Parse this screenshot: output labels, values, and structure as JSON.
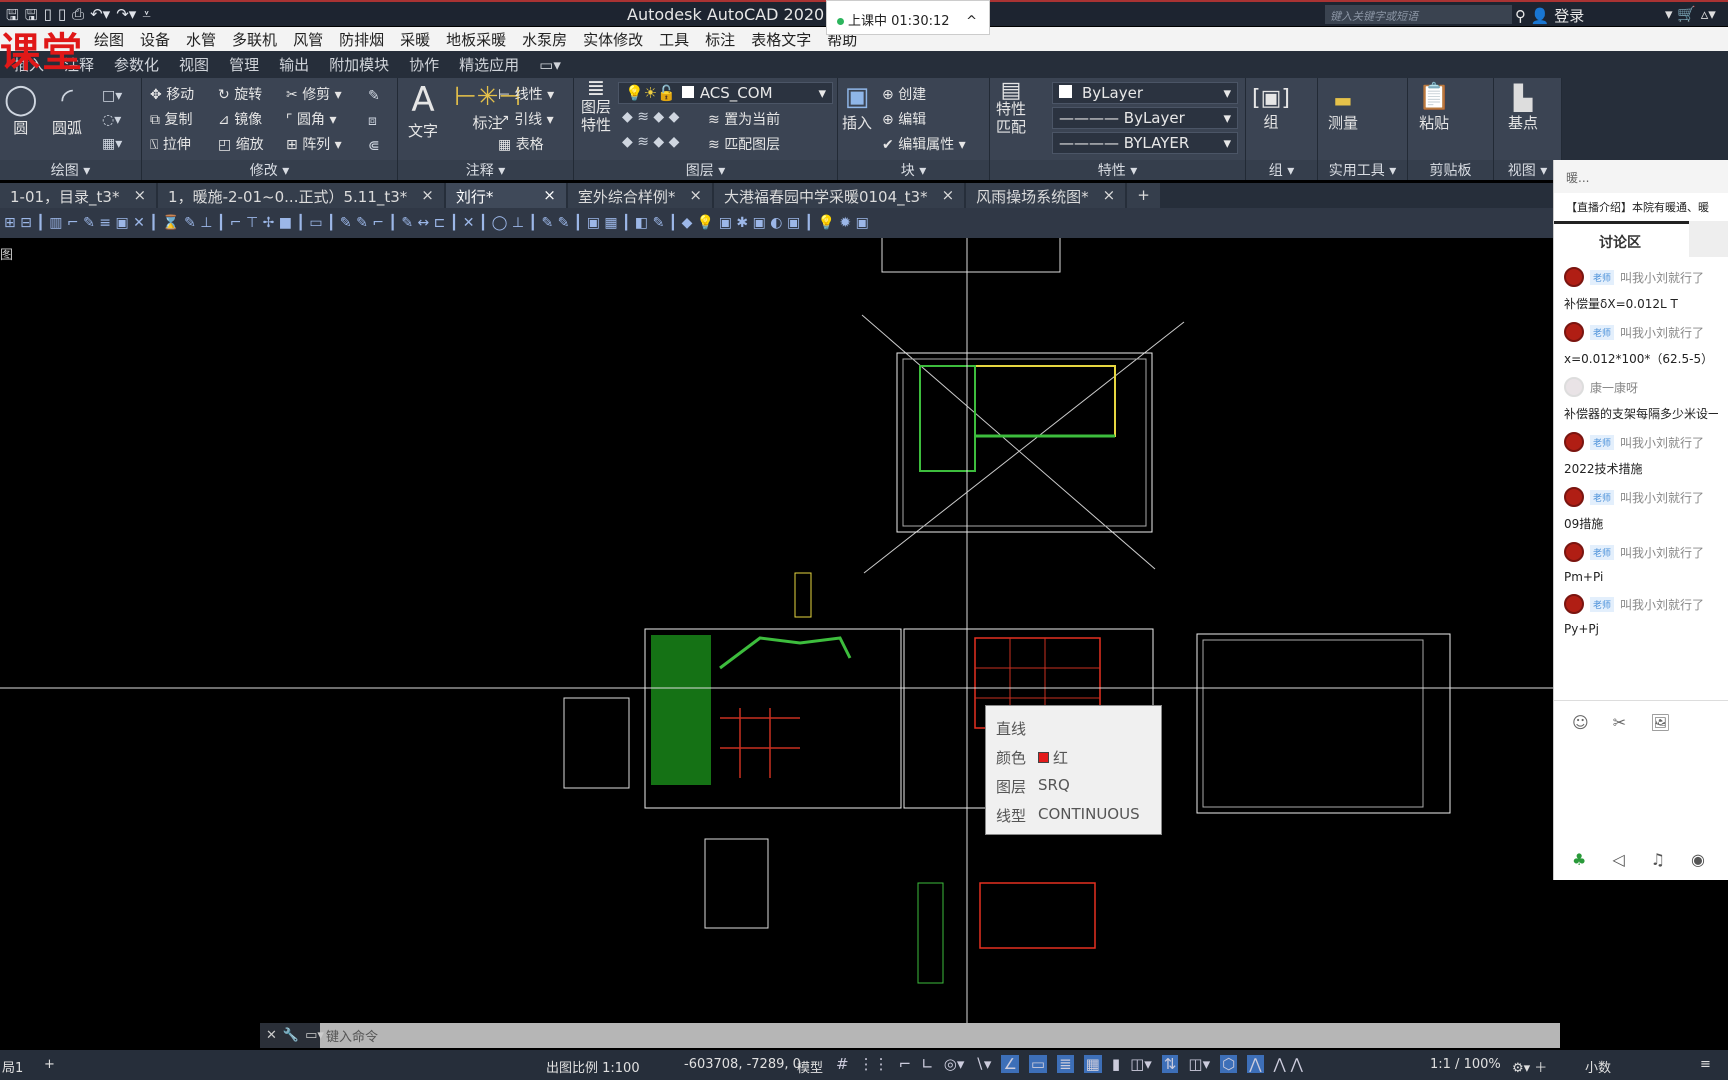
{
  "title_bar": {
    "app_title": "Autodesk AutoCAD 2020",
    "search_placeholder": "键入关键字或短语",
    "login": "登录"
  },
  "class_timer": {
    "label": "上课中 01:30:12",
    "chevron": "^"
  },
  "watermark": "课堂",
  "menu_bar": [
    "绘图",
    "设备",
    "水管",
    "多联机",
    "风管",
    "防排烟",
    "采暖",
    "地板采暖",
    "水泵房",
    "实体修改",
    "工具",
    "标注",
    "表格文字",
    "帮助"
  ],
  "ribbon_tabs": [
    "插入",
    "注释",
    "参数化",
    "视图",
    "管理",
    "输出",
    "附加模块",
    "协作",
    "精选应用"
  ],
  "ribbon": {
    "draw": {
      "label": "绘图",
      "circle": "圆",
      "arc": "圆弧"
    },
    "modify": {
      "label": "修改",
      "move": "移动",
      "rotate": "旋转",
      "trim": "修剪",
      "copy": "复制",
      "mirror": "镜像",
      "fillet": "圆角",
      "stretch": "拉伸",
      "scale": "缩放",
      "array": "阵列"
    },
    "annotation": {
      "label": "注释",
      "text": "文字",
      "dimension": "标注",
      "linear": "线性",
      "leader": "引线",
      "table": "表格"
    },
    "layers": {
      "label": "图层",
      "properties": "图层特性",
      "current_layer": "ACS_COM",
      "set_current": "置为当前",
      "match_layer": "匹配图层"
    },
    "block": {
      "label": "块",
      "insert": "插入",
      "create": "创建",
      "edit": "编辑",
      "edit_attributes": "编辑属性"
    },
    "properties": {
      "label": "特性",
      "match": "特性匹配",
      "color": "ByLayer",
      "linetype": "ByLayer",
      "lineweight": "BYLAYER"
    },
    "groups": {
      "label": "组",
      "group": "组"
    },
    "utilities": {
      "label": "实用工具",
      "measure": "测量"
    },
    "clipboard": {
      "label": "剪贴板",
      "paste": "粘贴"
    },
    "view": {
      "label": "视图",
      "base": "基点"
    }
  },
  "doc_tabs": [
    {
      "label": "1-01，目录_t3*"
    },
    {
      "label": "1，暖施-2-01~0...正式）5.11_t3*"
    },
    {
      "label": "刘行*",
      "active": true
    },
    {
      "label": "室外综合样例*"
    },
    {
      "label": "大港福春园中学采暖0104_t3*"
    },
    {
      "label": "风雨操场系统图*"
    }
  ],
  "viewport_label": "图",
  "tooltip": {
    "title": "直线",
    "color_label": "颜色",
    "color_value": "红",
    "color_hex": "#e31b1b",
    "layer_label": "图层",
    "layer_value": "SRQ",
    "linetype_label": "线型",
    "linetype_value": "CONTINUOUS"
  },
  "chat": {
    "header": "暖...",
    "intro": "【直播介绍】本院有暖通、暖",
    "tab": "讨论区",
    "messages": [
      {
        "user": "叫我小刘就行了",
        "badge": "老师",
        "text": "补偿量δX=0.012L T"
      },
      {
        "user": "叫我小刘就行了",
        "badge": "老师",
        "text": "x=0.012*100*（62.5-5）"
      },
      {
        "user": "康一康呀",
        "badge": "",
        "text": "补偿器的支架每隔多少米设一"
      },
      {
        "user": "叫我小刘就行了",
        "badge": "老师",
        "text": "2022技术措施"
      },
      {
        "user": "叫我小刘就行了",
        "badge": "老师",
        "text": "09措施"
      },
      {
        "user": "叫我小刘就行了",
        "badge": "老师",
        "text": "Pm+Pi"
      },
      {
        "user": "叫我小刘就行了",
        "badge": "老师",
        "text": "Py+Pj"
      }
    ]
  },
  "command_line": {
    "placeholder": "键入命令"
  },
  "status_bar": {
    "layout_tab": "局1",
    "plot_scale": "出图比例 1:100",
    "coordinates": "-603708, -7289, 0",
    "model": "模型",
    "annotation_scale": "1:1 / 100%",
    "units": "小数"
  },
  "colors": {
    "ribbon_bg": "#3b4453",
    "title_bg": "#1d2430",
    "canvas": "#000000",
    "accent_red": "#e01818"
  }
}
